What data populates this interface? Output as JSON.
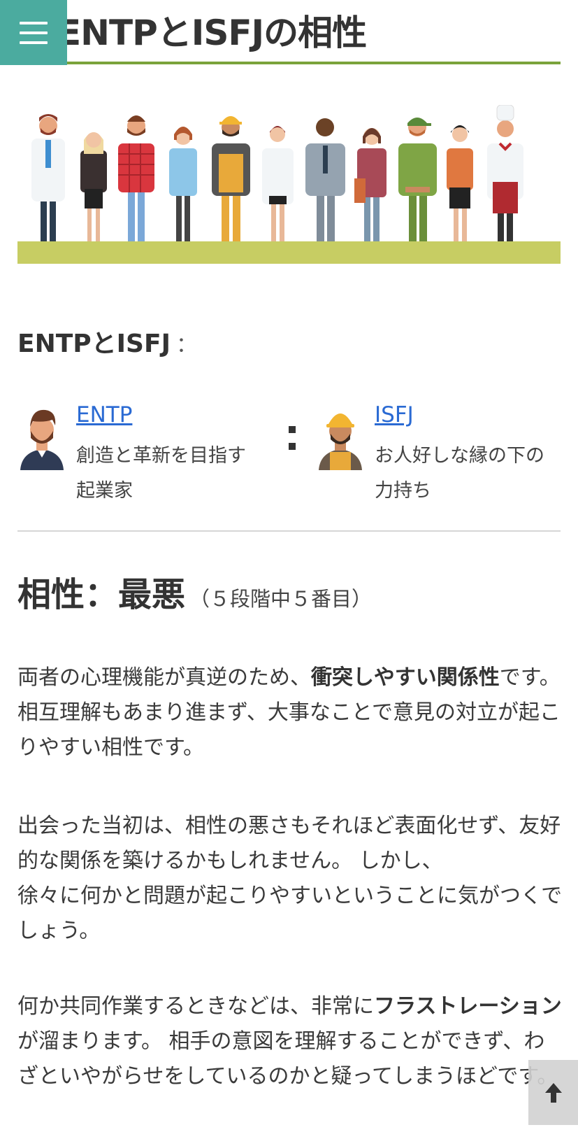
{
  "header": {
    "title": "ENTPとISFJの相性",
    "menu_icon": "hamburger-menu-icon",
    "accent_color": "#4bab9f",
    "rule_color": "#7aa33b"
  },
  "hero": {
    "image": "people-occupations-illustration",
    "ground_color": "#c7cd63"
  },
  "pair": {
    "heading": "ENTPとISFJ",
    "heading_sep": "：",
    "left": {
      "avatar": "bearded-businessman-avatar",
      "name": "ENTP",
      "desc_line1": "創造と革新を目指す",
      "desc_line2": "起業家"
    },
    "right": {
      "avatar": "hardhat-worker-avatar",
      "name": "ISFJ",
      "desc_line1": "お人好しな縁の下の",
      "desc_line2": "力持ち"
    }
  },
  "compatibility": {
    "label": "相性：最悪",
    "rank": "（５段階中５番目）"
  },
  "paragraphs": {
    "p1_a": "両者の心理機能が真逆のため、",
    "p1_b": "衝突しやすい関係性",
    "p1_c": "です。 相互理解もあまり進まず、大事なことで意見の対立が起こりやすい相性です。",
    "p2": "出会った当初は、相性の悪さもそれほど表面化せず、友好的な関係を築けるかもしれません。 しかし、",
    "p2_b": "徐々に何かと問題が起こりやすいということに気がつくでしょう。",
    "p3_a": "何か共同作業するときなどは、非常に",
    "p3_b": "フラストレーション",
    "p3_c": "が溜まります。 相手の意図を理解することができず、わざといやがらせをしているのかと疑ってしまうほどです。"
  },
  "scroll_top_icon": "arrow-up-icon"
}
